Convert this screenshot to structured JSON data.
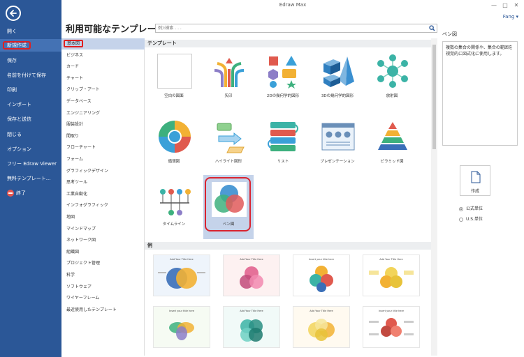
{
  "window": {
    "title": "Edraw Max",
    "user": "Fang ▾"
  },
  "sidebar": {
    "items": [
      {
        "label": "開く"
      },
      {
        "label": "新規作成"
      },
      {
        "label": "保存"
      },
      {
        "label": "名前を付けて保存"
      },
      {
        "label": "印刷"
      },
      {
        "label": "インポート"
      },
      {
        "label": "保存と送信"
      },
      {
        "label": "閉じる"
      },
      {
        "label": "オプション"
      },
      {
        "label": "フリー Edraw Viewer"
      },
      {
        "label": "無料テンプレート..."
      },
      {
        "label": "終了"
      }
    ]
  },
  "main": {
    "heading": "利用可能なテンプレート",
    "search_placeholder": "例):検索 . . ."
  },
  "categories": [
    "基本図",
    "ビジネス",
    "カード",
    "チャート",
    "クリップ・アート",
    "データベース",
    "エンジニアリング",
    "服装設計",
    "間取り",
    "フローチャート",
    "フォーム",
    "グラフィックデザイン",
    "思考ツール",
    "工業自動化",
    "インフォグラフィック",
    "地図",
    "マインドマップ",
    "ネットワーク図",
    "組織図",
    "プロジェクト管理",
    "科学",
    "ソフトウェア",
    "ワイヤーフレーム",
    "最近使用したテンプレート"
  ],
  "templates_section": "テンプレート",
  "templates": [
    "空白の図面",
    "矢印",
    "2Dの幾何学的図形",
    "3Dの幾何学的図形",
    "放射図",
    "循環図",
    "ハイライト図形",
    "リスト",
    "プレゼンテーション",
    "ピラミッド図",
    "タイムライン",
    "ベン図"
  ],
  "examples_section": "例",
  "examples": [
    "Add Your Title Here",
    "Add Your Title Here",
    "Insert your title here",
    "Add Your Title Here",
    "Insert your title here",
    "Add Your Title Here",
    "Add Your Title Here",
    "Insert your title here"
  ],
  "right_panel": {
    "title": "ベン図",
    "description": "複数の集合の関係や、集合の範囲を視覚的に図式化に使用します。",
    "create_label": "作成",
    "units": [
      {
        "label": "公式単位",
        "selected": true
      },
      {
        "label": "U.S.単位",
        "selected": false
      }
    ]
  },
  "colors": {
    "sidebar": "#2b5797",
    "accent_red": "#d9232f",
    "selected_bg": "#c5d3ea"
  }
}
